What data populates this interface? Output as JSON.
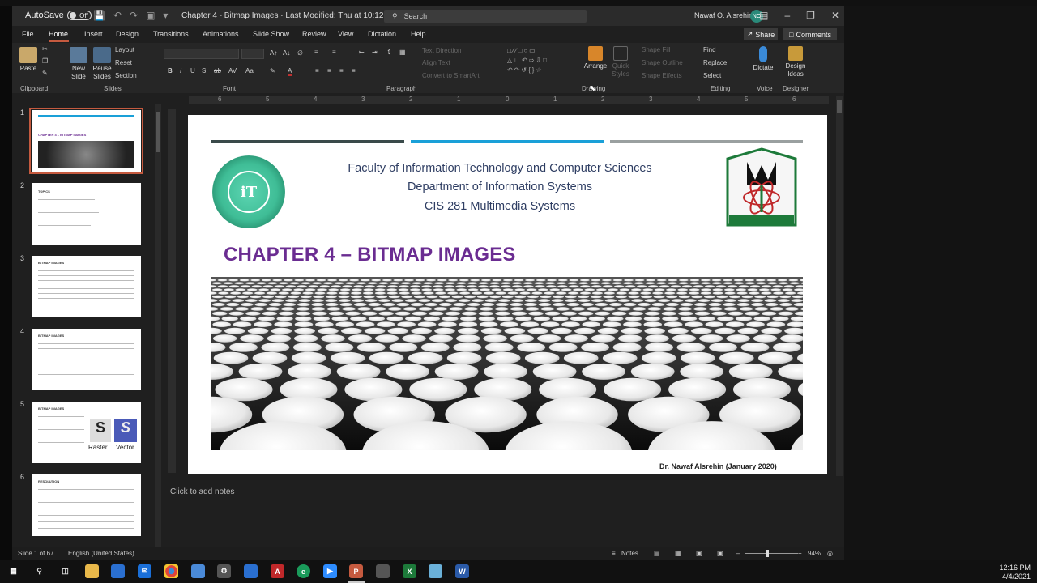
{
  "titlebar": {
    "autosave_label": "AutoSave",
    "autosave_state": "Off",
    "doc_title": "Chapter 4 - Bitmap Images  ·  Last Modified: Thu at 10:12 AM",
    "search_placeholder": "Search",
    "user_name": "Nawaf O. Alsrehin",
    "user_initials": "NO"
  },
  "menu": {
    "tabs": [
      "File",
      "Home",
      "Insert",
      "Design",
      "Transitions",
      "Animations",
      "Slide Show",
      "Review",
      "View",
      "Dictation",
      "Help"
    ],
    "active": "Home",
    "share": "Share",
    "comments": "Comments"
  },
  "ribbon": {
    "paste": "Paste",
    "new_slide": "New Slide",
    "reuse_slides": "Reuse Slides",
    "layout": "Layout",
    "reset": "Reset",
    "section": "Section",
    "text_direction": "Text Direction",
    "align_text": "Align Text",
    "convert_smartart": "Convert to SmartArt",
    "arrange": "Arrange",
    "quick_styles": "Quick Styles",
    "shape_fill": "Shape Fill",
    "shape_outline": "Shape Outline",
    "shape_effects": "Shape Effects",
    "find": "Find",
    "replace": "Replace",
    "select": "Select",
    "dictate": "Dictate",
    "design_ideas": "Design Ideas",
    "groups": {
      "clipboard": "Clipboard",
      "slides": "Slides",
      "font": "Font",
      "paragraph": "Paragraph",
      "drawing": "Drawing",
      "editing": "Editing",
      "voice": "Voice",
      "designer": "Designer"
    }
  },
  "thumbnails": [
    {
      "num": "1",
      "title": "CHAPTER 4 – BITMAP IMAGES"
    },
    {
      "num": "2",
      "title": "TOPICS"
    },
    {
      "num": "3",
      "title": "BITMAP IMAGES"
    },
    {
      "num": "4",
      "title": "BITMAP IMAGES"
    },
    {
      "num": "5",
      "title": "BITMAP IMAGES"
    },
    {
      "num": "6",
      "title": "RESOLUTION"
    },
    {
      "num": "7",
      "title": ""
    }
  ],
  "thumb5": {
    "raster": "Raster",
    "vector": "Vector"
  },
  "ruler": [
    "6",
    "5",
    "4",
    "3",
    "2",
    "1",
    "0",
    "1",
    "2",
    "3",
    "4",
    "5",
    "6"
  ],
  "slide": {
    "line1": "Faculty of Information Technology and Computer Sciences",
    "line2": "Department of Information Systems",
    "line3": "CIS 281 Multimedia Systems",
    "chapter": "CHAPTER 4 – BITMAP IMAGES",
    "author": "Dr. Nawaf Alsrehin (January 2020)",
    "bar_colors": [
      "#3a4a4a",
      "#1aa0d8",
      "#9aa0a0"
    ],
    "title_color": "#6a2c91"
  },
  "notes_placeholder": "Click to add notes",
  "status": {
    "slide_count": "Slide 1 of 67",
    "language": "English (United States)",
    "notes": "Notes",
    "zoom": "94%"
  },
  "clock": {
    "time": "12:16 PM",
    "date": "4/4/2021"
  }
}
